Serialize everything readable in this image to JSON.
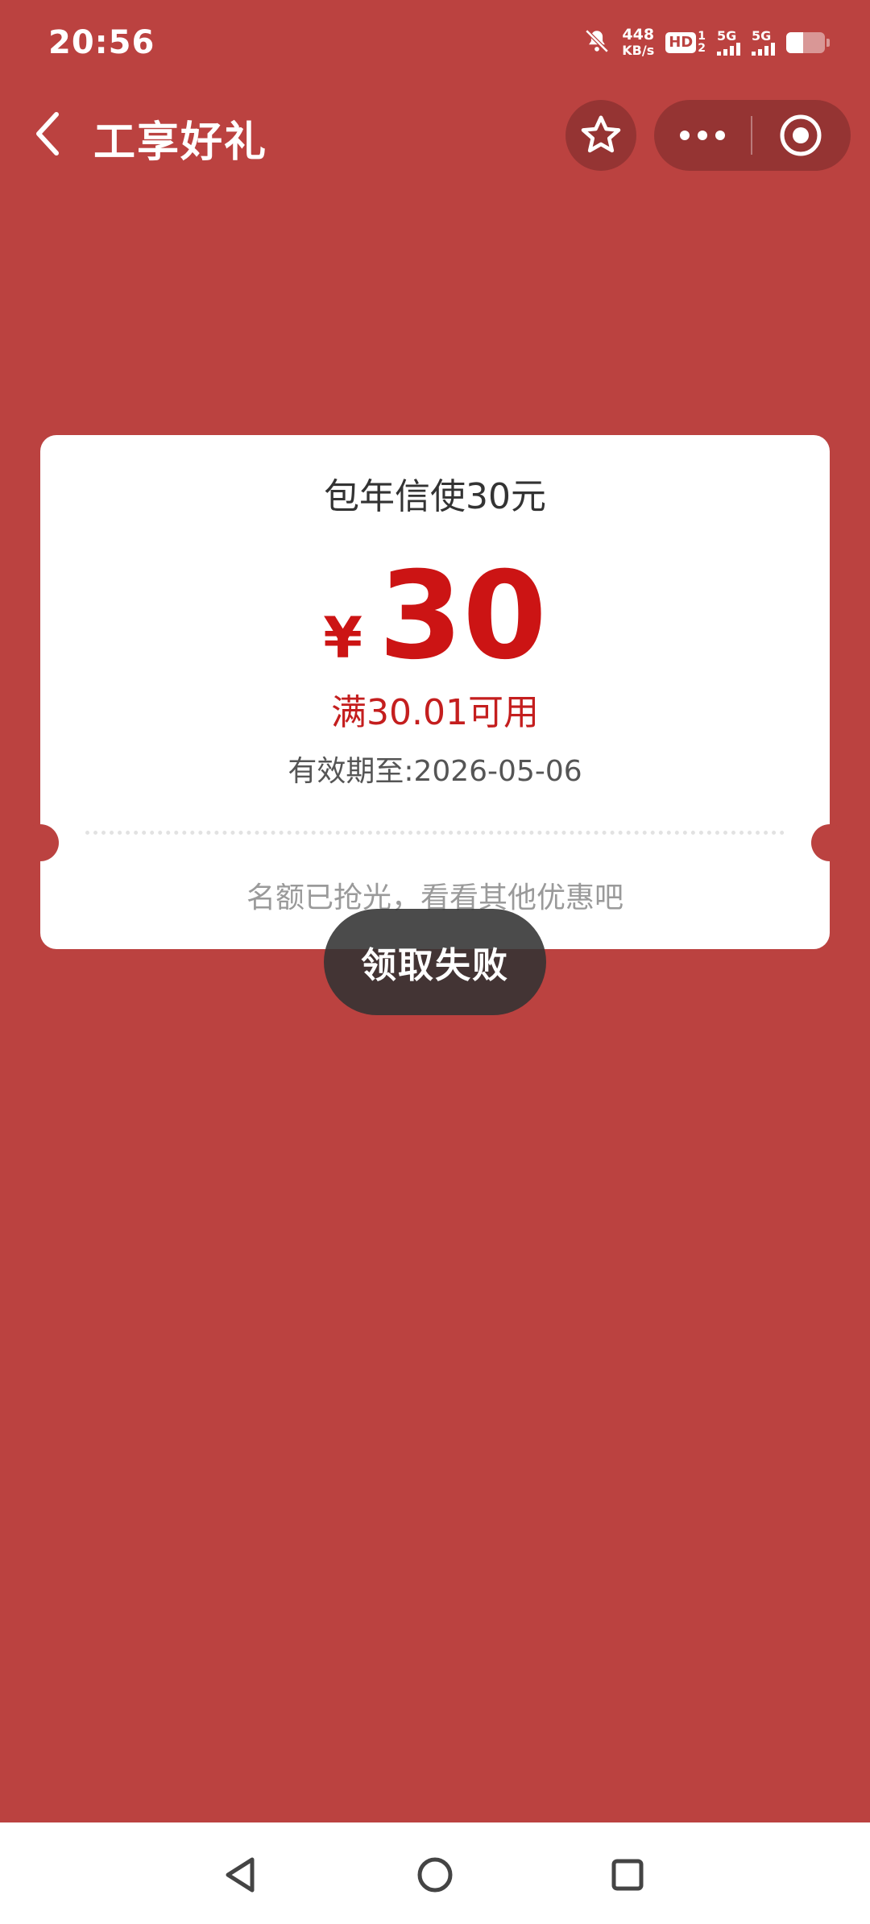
{
  "status_bar": {
    "time": "20:56",
    "net_speed_value": "448",
    "net_speed_unit": "KB/s",
    "hd_label": "HD",
    "hd_sub_1": "1",
    "hd_sub_2": "2",
    "sim1_label": "5G",
    "sim2_label": "5G",
    "icons": [
      "mute-bell-icon",
      "signal-icon",
      "battery-icon"
    ]
  },
  "header": {
    "title": "工享好礼",
    "icons": [
      "back-arrow-icon",
      "star-icon",
      "more-dots-icon",
      "close-target-icon"
    ]
  },
  "coupon": {
    "name": "包年信使30元",
    "currency": "¥",
    "amount": "30",
    "condition": "满30.01可用",
    "expiry": "有效期至:2026-05-06",
    "status_text": "名额已抢光，看看其他优惠吧"
  },
  "toast": {
    "message": "领取失败"
  },
  "nav_bar": {
    "icons": [
      "nav-back-icon",
      "nav-home-icon",
      "nav-recent-icon"
    ]
  },
  "colors": {
    "background": "#bb4240",
    "accent_red": "#cc1414",
    "card": "#ffffff"
  }
}
